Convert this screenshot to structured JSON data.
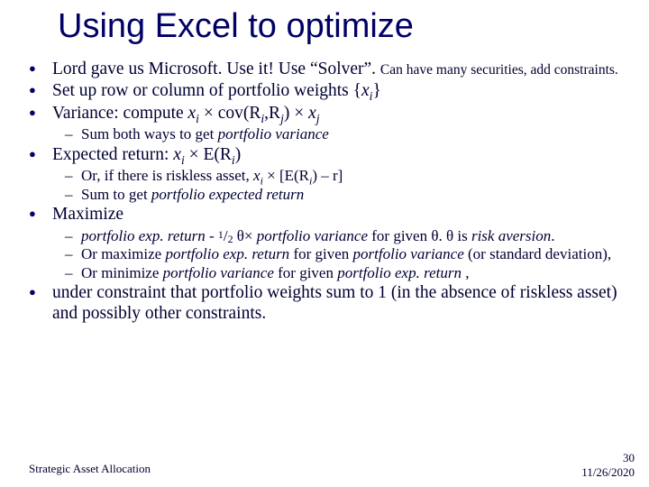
{
  "title": "Using Excel to optimize",
  "b1_main": "Lord gave us Microsoft.  Use it! Use “Solver”. ",
  "b1_small": "Can have many securities, add constraints.",
  "b2_a": "Set up row or column of portfolio weights {",
  "b2_xi": "x",
  "b2_i": "i",
  "b2_b": "}",
  "b3_a": "Variance: compute ",
  "b3_x1": "x",
  "b3_i1": "i",
  "b3_mid": " × cov(R",
  "b3_ri": "i",
  "b3_comma": ",R",
  "b3_rj": "j",
  "b3_close": ") × ",
  "b3_x2": "x",
  "b3_j2": "j",
  "b3s_a": "Sum both ways to get ",
  "b3s_em": "portfolio variance",
  "b4_a": "Expected return: ",
  "b4_x": "x",
  "b4_i": "i",
  "b4_mid": " × E(R",
  "b4_ri": "i",
  "b4_close": ")",
  "b4s1_a": "Or, if there is riskless asset, ",
  "b4s1_x": "x",
  "b4s1_i": "i",
  "b4s1_mid": " × [E(R",
  "b4s1_ri": "i",
  "b4s1_close": ") – r]",
  "b4s2_a": "Sum to get ",
  "b4s2_em": "portfolio expected return",
  "b5": "Maximize",
  "b5s1_a": "portfolio exp. return",
  "b5s1_b": " - ",
  "b5s1_half1": "1",
  "b5s1_slash": "/",
  "b5s1_half2": "2",
  "b5s1_c": " θ× ",
  "b5s1_d": "portfolio variance",
  "b5s1_e": "  for given θ.  θ is ",
  "b5s1_f": "risk aversion",
  "b5s1_g": ".",
  "b5s2_a": "Or maximize ",
  "b5s2_b": "portfolio exp. return",
  "b5s2_c": " for given ",
  "b5s2_d": "portfolio variance",
  "b5s2_e": " (or standard deviation),",
  "b5s3_a": "Or minimize ",
  "b5s3_b": "portfolio variance",
  "b5s3_c": " for given ",
  "b5s3_d": "portfolio exp. return",
  "b5s3_e": " ,",
  "b6": "under constraint that portfolio weights sum to 1 (in the absence of riskless asset) and possibly other constraints.",
  "footer_left": "Strategic Asset Allocation",
  "footer_num": "30",
  "footer_date": "11/26/2020"
}
